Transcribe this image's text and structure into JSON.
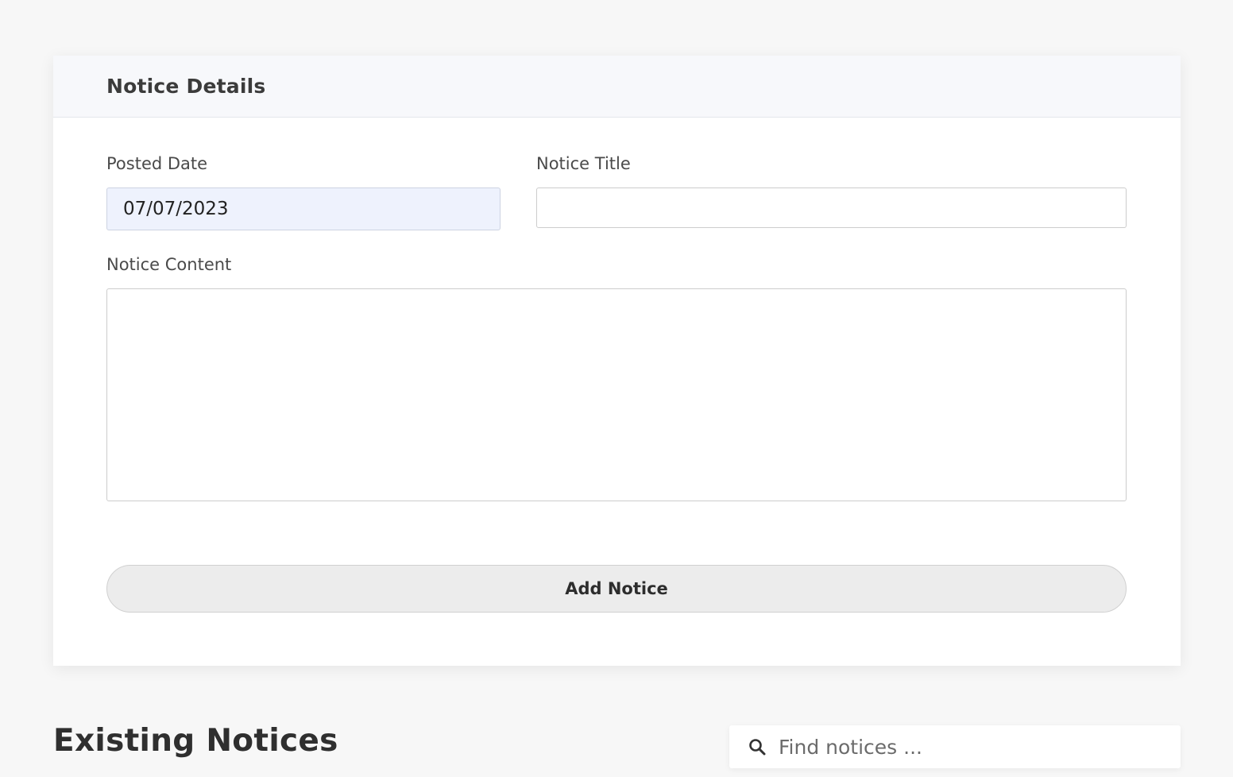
{
  "form": {
    "header_title": "Notice Details",
    "posted_date_label": "Posted Date",
    "posted_date_value": "07/07/2023",
    "notice_title_label": "Notice Title",
    "notice_title_value": "",
    "notice_content_label": "Notice Content",
    "notice_content_value": "",
    "submit_label": "Add Notice"
  },
  "existing": {
    "section_title": "Existing Notices",
    "search_placeholder": "Find notices ...",
    "search_icon": "search-icon"
  }
}
